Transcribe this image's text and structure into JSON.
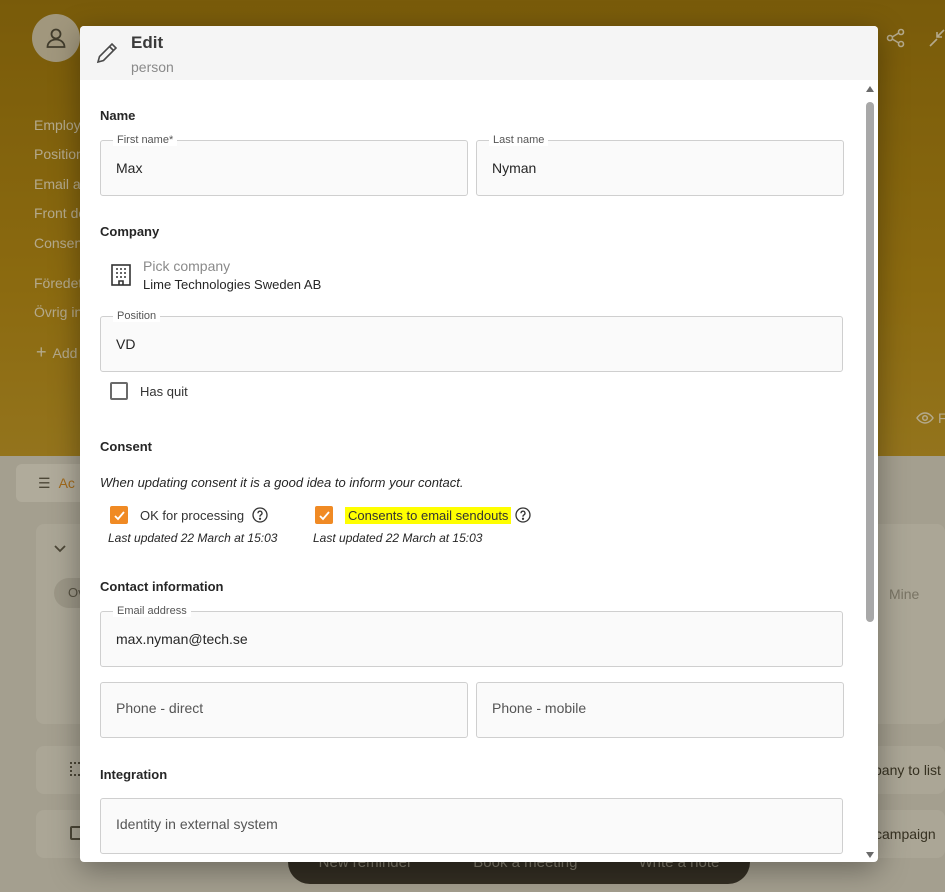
{
  "background": {
    "fields": [
      "Employ",
      "Position",
      "Email a",
      "Front de",
      "Consen",
      "Föredet",
      "Övrig in"
    ],
    "add_label": "Add",
    "eye_label": "F",
    "tab_label": "Ac",
    "pill_label": "Ov",
    "mine_label": "Mine",
    "row1_text": "pany to list",
    "row2_text": "l campaign",
    "bottom_actions": [
      "New reminder",
      "Book a meeting",
      "Write a note"
    ]
  },
  "modal": {
    "title": "Edit",
    "subtitle": "person",
    "sections": {
      "name": "Name",
      "company": "Company",
      "consent": "Consent",
      "contact": "Contact information",
      "integration": "Integration"
    },
    "first_name": {
      "label": "First name*",
      "value": "Max"
    },
    "last_name": {
      "label": "Last name",
      "value": "Nyman"
    },
    "company_pick": {
      "placeholder": "Pick company",
      "value": "Lime Technologies Sweden AB"
    },
    "position": {
      "label": "Position",
      "value": "VD"
    },
    "has_quit": {
      "label": "Has quit",
      "checked": false
    },
    "consent_note": "When updating consent it is a good idea to inform your contact.",
    "ok_processing": {
      "label": "OK for processing",
      "checked": true,
      "updated": "Last updated 22 March at 15:03"
    },
    "email_consent": {
      "label": "Consents to email sendouts",
      "checked": true,
      "updated": "Last updated 22 March at 15:03"
    },
    "email": {
      "label": "Email address",
      "value": "max.nyman@tech.se"
    },
    "phone_direct": {
      "placeholder": "Phone - direct"
    },
    "phone_mobile": {
      "placeholder": "Phone - mobile"
    },
    "external_id": {
      "placeholder": "Identity in external system"
    }
  },
  "colors": {
    "accent": "#f08a24",
    "header_bg": "#b58a18",
    "highlight": "#ffff00"
  }
}
